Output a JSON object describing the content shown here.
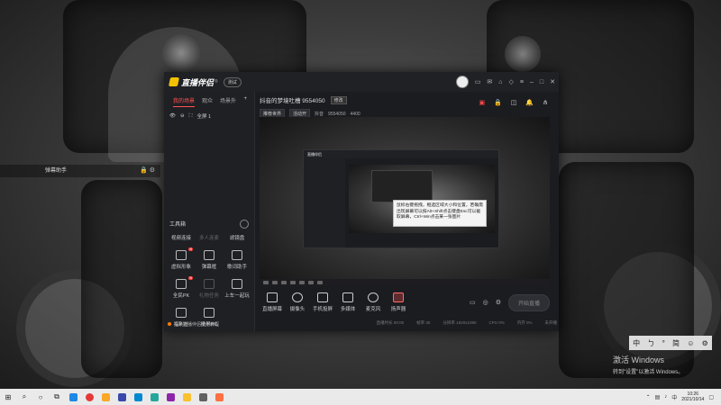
{
  "desktop": {
    "widget_label": "弹幕助手",
    "widget_icons": "🔒 ⚙",
    "ime_items": [
      "中",
      "ㄅ",
      "°",
      "简",
      "☺",
      "⚙"
    ],
    "activation_title": "激活 Windows",
    "activation_sub": "转到\"设置\"以激活 Windows。"
  },
  "app": {
    "name": "直播伴侣",
    "name_sup": "®",
    "version_pill": "测试",
    "titlebar_icons": [
      "msg-icon",
      "mail-icon",
      "shirt-icon",
      "gift-icon",
      "menu-icon",
      "minimize-icon",
      "maximize-icon",
      "close-icon"
    ]
  },
  "left_panel": {
    "tabs": [
      "我的场景",
      "观众",
      "场景外"
    ],
    "active_tab": 0,
    "plus": "+",
    "scene_label": "全屏 1",
    "tools_header": "工具箱",
    "tool_rows": [
      [
        "视频连接",
        "多人连麦",
        "滤镜盘"
      ],
      [
        "虚拟形象",
        "弹幕框",
        "歌词助手"
      ],
      [
        "全民PK",
        "礼物任务",
        "上车一起玩"
      ],
      [
        "福利社",
        "投屏PC"
      ]
    ],
    "footer": "头条直播伴侣使用教程"
  },
  "main": {
    "title": "抖音的梦境吐槽 9554050",
    "edit_btn": "修改",
    "meta": [
      "推荐世界",
      "活动开",
      "抖音",
      "9554050",
      "4400"
    ],
    "header_icons": [
      "task-icon",
      "lock-icon",
      "box-icon",
      "bell-icon",
      "share-icon"
    ]
  },
  "preview": {
    "nested_title": "直播伴侣",
    "tooltip": "鼠标右键拖拽，框选区域大小和位置，若确需出现屏幕可以按Alt+Shift点击键盘Esc可以截取屏幕，Ctrl+Win点击某一张图片"
  },
  "bottom_tools": [
    "直播屏幕",
    "摄像头",
    "手机投屏",
    "多媒体",
    "麦克风",
    "扬声器"
  ],
  "start_btn": "开始直播",
  "status": [
    "直播时长 00:00",
    "帧率 30",
    "分辨率 1920x1080",
    "CPU 0%",
    "内存 0%",
    "未开播"
  ],
  "taskbar": {
    "clock_time": "10:26",
    "clock_date": "2021/10/14",
    "apps": [
      {
        "name": "edge-app",
        "color": "#1e88e5"
      },
      {
        "name": "chrome-app",
        "color": "#e53935"
      },
      {
        "name": "explorer-app",
        "color": "#f9a825"
      },
      {
        "name": "store-app",
        "color": "#3949ab"
      },
      {
        "name": "mail-app",
        "color": "#0288d1"
      },
      {
        "name": "qq-app",
        "color": "#26a69a"
      },
      {
        "name": "game-app",
        "color": "#8e24aa"
      },
      {
        "name": "folder-app",
        "color": "#fbc02d"
      },
      {
        "name": "settings-app",
        "color": "#616161"
      },
      {
        "name": "live-app",
        "color": "#ff7043"
      }
    ]
  }
}
